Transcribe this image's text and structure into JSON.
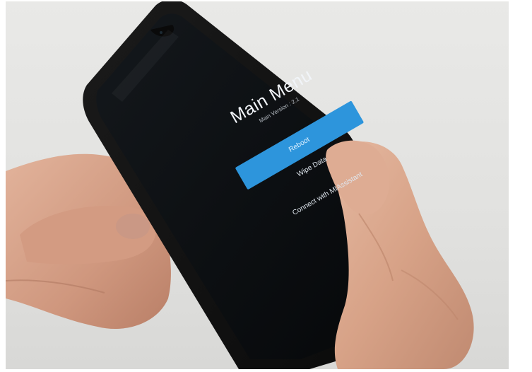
{
  "phone_screen": {
    "title": "Main Menu",
    "version": "Main Version : 2.1",
    "menu_items": [
      {
        "label": "Reboot",
        "highlighted": true
      },
      {
        "label": "Wipe Data",
        "highlighted": false
      },
      {
        "label": "Connect with MIAssistant",
        "highlighted": false
      }
    ]
  },
  "colors": {
    "background_wall": "#e3e3e1",
    "phone_body": "#141414",
    "screen": "#0d1013",
    "highlight_button": "#2d95dc",
    "skin": "#d9a48a"
  }
}
